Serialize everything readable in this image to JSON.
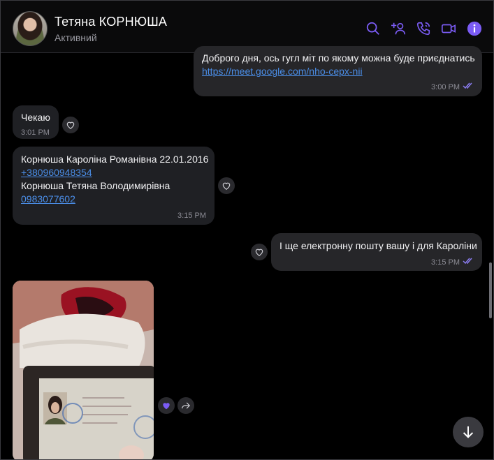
{
  "header": {
    "contact_name": "Тетяна КОРНЮША",
    "status": "Активний",
    "icons": [
      "search-icon",
      "add-participant-icon",
      "call-icon",
      "video-call-icon",
      "info-icon"
    ],
    "accent": "#7b5cf5"
  },
  "messages": [
    {
      "direction": "out",
      "text": "Доброго дня, ось гугл міт по якому можна буде приєднатись",
      "link": "https://meet.google.com/nho-cepx-nii",
      "time": "3:00 PM",
      "status": "read"
    },
    {
      "direction": "in",
      "text": "Чекаю",
      "time": "3:01 PM"
    },
    {
      "direction": "in",
      "line1": "Корнюша Кароліна Романівна 22.01.2016",
      "link1": "+380960948354",
      "line2": "Корнюша Тетяна Володимирівна",
      "link2": "0983077602",
      "time": "3:15 PM"
    },
    {
      "direction": "out",
      "text": "І ще електронну пошту вашу і для Кароліни",
      "time": "3:15 PM",
      "status": "read"
    },
    {
      "direction": "in",
      "type": "photo",
      "caption": ""
    }
  ],
  "colors": {
    "bubble_out": "#262629",
    "bubble_in": "#1f2024",
    "link": "#4b8ee8",
    "time": "#8d8d96",
    "read_ticks": "#8a7cf0",
    "heart_liked": "#7b5cf5"
  }
}
